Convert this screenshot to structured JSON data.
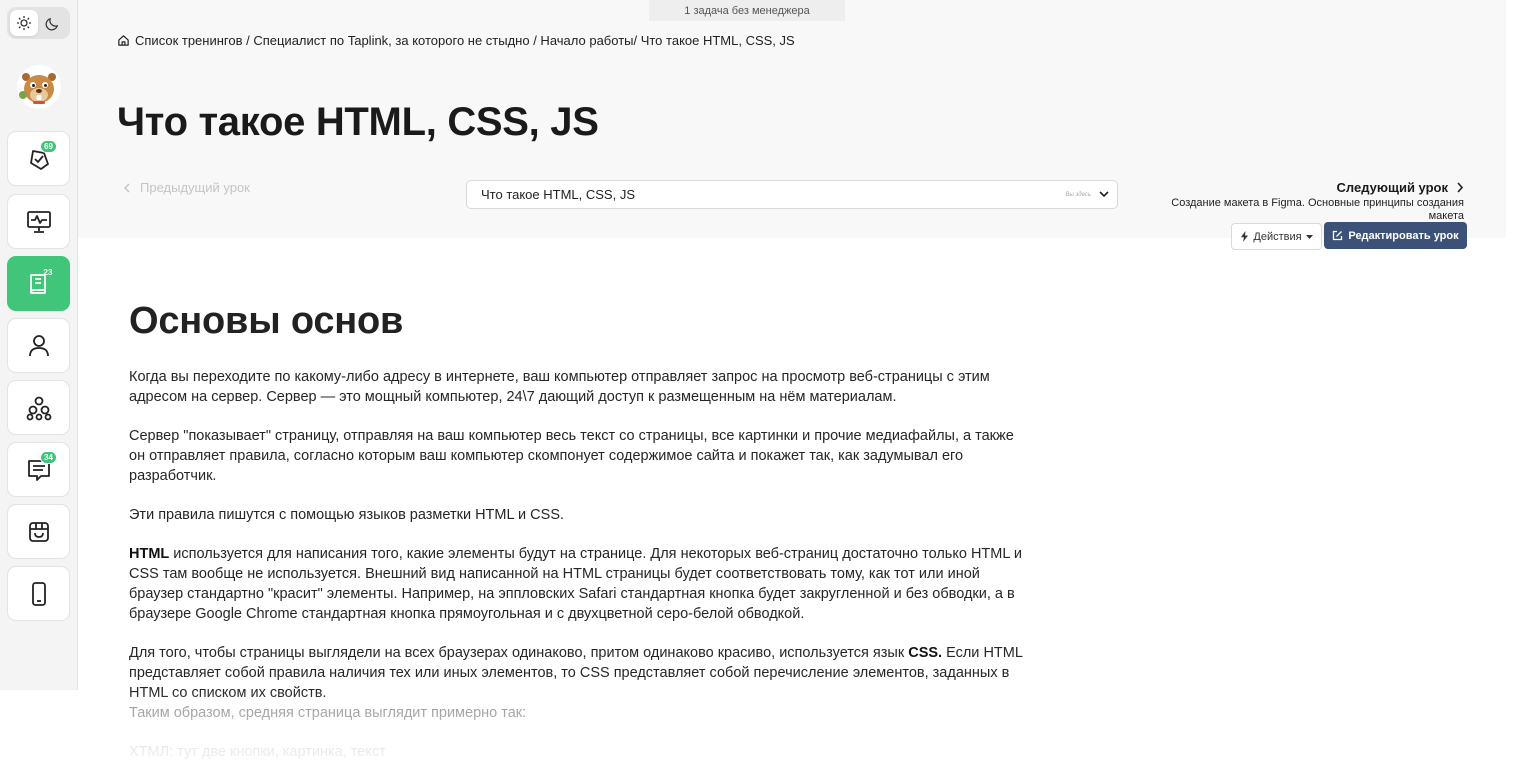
{
  "top_tab": "1 задача без менеджера",
  "breadcrumb": {
    "text": "Список тренингов / Специалист по Taplink, за которого не стыдно / Начало работы/ Что такое HTML, CSS, JS"
  },
  "page_title": "Что такое HTML, CSS, JS",
  "nav": {
    "prev_label": "Предыдущий урок",
    "select_value": "Что такое HTML, CSS, JS",
    "select_hint": "Вы здесь",
    "next_label": "Следующий урок",
    "next_subtitle": "Создание макета в Figma. Основные принципы создания макета"
  },
  "toolbar": {
    "actions_label": "Действия",
    "edit_label": "Редактировать урок"
  },
  "sidebar": {
    "badges": {
      "tasks": "69",
      "lessons": "23",
      "messages": "34"
    }
  },
  "content": {
    "heading": "Основы основ",
    "p1": "Когда вы переходите по какому-либо адресу в интернете, ваш компьютер отправляет запрос на просмотр веб-страницы с этим адресом на сервер. Сервер — это мощный компьютер, 24\\7 дающий доступ к размещенным на нём материалам.",
    "p2": "Сервер \"показывает\" страницу, отправляя на ваш компьютер весь текст со страницы, все картинки и прочие медиафайлы, а также он отправляет правила, согласно которым ваш компьютер скомпонует содержимое сайта и покажет так, как задумывал его разработчик.",
    "p3": "Эти правила пишутся с помощью языков разметки HTML и CSS.",
    "p4_bold": "HTML",
    "p4": " используется для написания того, какие элементы будут на странице. Для некоторых веб-страниц достаточно только HTML и CSS там вообще не используется. Внешний вид написанной на HTML страницы будет соответствовать тому, как тот или иной браузер стандартно \"красит\" элементы. Например, на эппловских Safari стандартная кнопка будет закругленной и без обводки, а в браузере Google Chrome стандартная кнопка прямоугольная и с двухцветной серо-белой обводкой.",
    "p5_start": "Для того, чтобы страницы выглядели на всех браузерах одинаково, притом одинаково красиво, используется язык ",
    "p5_bold": "CSS.",
    "p5_end": " Если HTML представляет собой правила наличия тех или иных элементов, то CSS представляет собой перечисление элементов, заданных в HTML со списком их свойств.",
    "p6": "Таким образом, средняя страница выглядит примерно так:",
    "p7": "ХТМЛ: тут две кнопки, картинка, текст"
  },
  "colors": {
    "accent_green": "#40c57a",
    "edit_button": "#3b5178"
  }
}
